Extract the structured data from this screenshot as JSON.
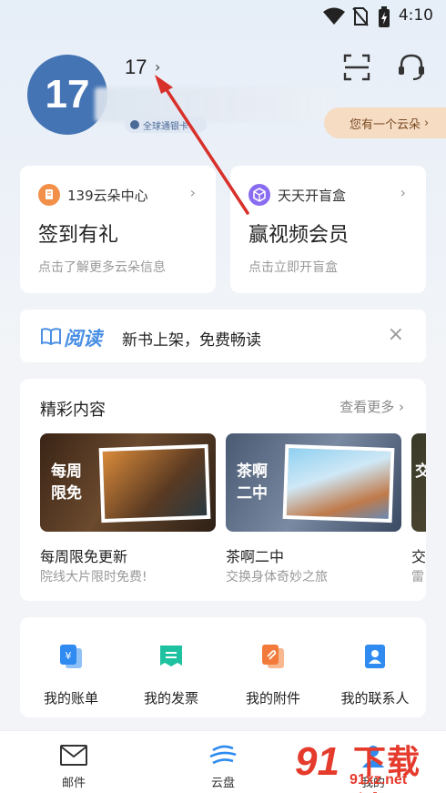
{
  "status_bar": {
    "time": "4:10"
  },
  "profile": {
    "avatar_text": "17",
    "username": "17",
    "member_badge": "全球通银卡",
    "cloud_prompt": "您有一个云朵"
  },
  "promo_cards": [
    {
      "tag": "139云朵中心",
      "title": "签到有礼",
      "subtitle": "点击了解更多云朵信息"
    },
    {
      "tag": "天天开盲盒",
      "title": "赢视频会员",
      "subtitle": "点击立即开盲盒"
    }
  ],
  "read_banner": {
    "brand": "阅读",
    "text": "新书上架，免费畅读",
    "close": "×"
  },
  "featured": {
    "title": "精彩内容",
    "more": "查看更多",
    "items": [
      {
        "thumb_label_1": "每周",
        "thumb_label_2": "限免",
        "title": "每周限免更新",
        "subtitle": "院线大片限时免费!"
      },
      {
        "thumb_label_1": "茶啊",
        "thumb_label_2": "二中",
        "title": "茶啊二中",
        "subtitle": "交换身体奇妙之旅"
      },
      {
        "thumb_label_1": "交",
        "thumb_label_2": "",
        "title": "交",
        "subtitle": "雷"
      }
    ]
  },
  "shortcuts": [
    {
      "label": "我的账单",
      "icon": "bill-icon",
      "color": "#2f8bf0"
    },
    {
      "label": "我的发票",
      "icon": "invoice-icon",
      "color": "#1fc2a0"
    },
    {
      "label": "我的附件",
      "icon": "attachment-icon",
      "color": "#f27a3a"
    },
    {
      "label": "我的联系人",
      "icon": "contact-icon",
      "color": "#2f8bf0"
    }
  ],
  "tab_bar": [
    {
      "label": "邮件",
      "icon": "mail-icon"
    },
    {
      "label": "云盘",
      "icon": "cloud-icon"
    },
    {
      "label": "我的",
      "icon": "profile-icon"
    }
  ],
  "watermark": {
    "brand": "下载站",
    "url": "91xz.net",
    "number": "91"
  },
  "colors": {
    "accent": "#2f8bf0",
    "avatar": "#4474b4",
    "annotation_arrow": "#d8302a"
  }
}
